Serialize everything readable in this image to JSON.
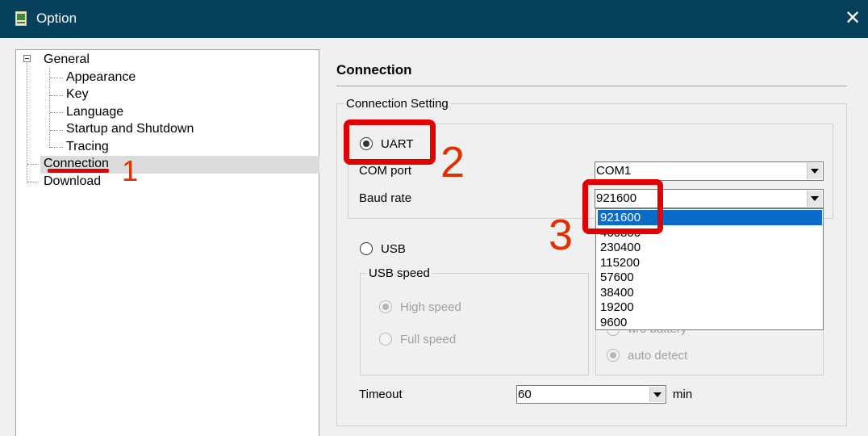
{
  "window": {
    "title": "Option",
    "close_glyph": "✕"
  },
  "tree": {
    "items": [
      {
        "label": "General"
      },
      {
        "label": "Appearance"
      },
      {
        "label": "Key"
      },
      {
        "label": "Language"
      },
      {
        "label": "Startup and Shutdown"
      },
      {
        "label": "Tracing"
      },
      {
        "label": "Connection",
        "selected": true
      },
      {
        "label": "Download"
      }
    ]
  },
  "main": {
    "heading": "Connection",
    "connection_setting": {
      "legend": "Connection Setting",
      "uart": {
        "label": "UART",
        "checked": true,
        "com_port_label": "COM port",
        "com_port_value": "COM1",
        "baud_rate_label": "Baud rate",
        "baud_rate_value": "921600",
        "baud_rate_options": [
          "921600",
          "460800",
          "230400",
          "115200",
          "57600",
          "38400",
          "19200",
          "9600"
        ]
      },
      "usb": {
        "label": "USB",
        "checked": false,
        "speed_legend": "USB speed",
        "high_speed_label": "High speed",
        "full_speed_label": "Full speed",
        "battery_label": "w/o battery",
        "auto_detect_label": "auto detect"
      },
      "timeout_label": "Timeout",
      "timeout_value": "60",
      "timeout_unit": "min"
    }
  },
  "annotations": {
    "step1": "1",
    "step2": "2",
    "step3": "3"
  },
  "colors": {
    "titlebar": "#07405c",
    "highlight": "#0a6bc9",
    "annotation_red": "#e30000"
  },
  "icons": {
    "app": "app-icon",
    "close": "close-icon",
    "expander": "tree-collapse-icon",
    "combo_arrow": "chevron-down-icon"
  }
}
